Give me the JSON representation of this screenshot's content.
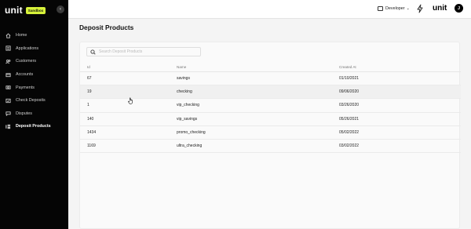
{
  "sidebar": {
    "logo": "unit",
    "badge": "Sandbox",
    "collapse_glyph": "‹",
    "items": [
      {
        "label": "Home",
        "icon": "home-icon"
      },
      {
        "label": "Applications",
        "icon": "applications-icon"
      },
      {
        "label": "Customers",
        "icon": "customers-icon"
      },
      {
        "label": "Accounts",
        "icon": "accounts-icon"
      },
      {
        "label": "Payments",
        "icon": "payments-icon"
      },
      {
        "label": "Check Deposits",
        "icon": "check-deposits-icon"
      },
      {
        "label": "Disputes",
        "icon": "disputes-icon"
      },
      {
        "label": "Deposit Products",
        "icon": "deposit-products-icon",
        "active": true
      }
    ]
  },
  "topbar": {
    "environment": "Developer",
    "logo": "unit",
    "avatar_initial": "J"
  },
  "page": {
    "title": "Deposit Products"
  },
  "search": {
    "placeholder": "Search Deposit Products"
  },
  "table": {
    "columns": [
      "Id",
      "Name",
      "Created At"
    ],
    "rows": [
      [
        "67",
        "savings",
        "01/10/2021"
      ],
      [
        "19",
        "checking",
        "09/06/2020"
      ],
      [
        "1",
        "vip_checking",
        "03/26/2020"
      ],
      [
        "140",
        "vip_savings",
        "05/26/2021"
      ],
      [
        "1434",
        "promo_checking",
        "05/02/2022"
      ],
      [
        "1169",
        "ultra_checking",
        "03/02/2022"
      ]
    ]
  },
  "colors": {
    "sidebar_bg": "#050505",
    "badge_bg": "#d7f23a",
    "page_bg": "#f4f4f4"
  }
}
